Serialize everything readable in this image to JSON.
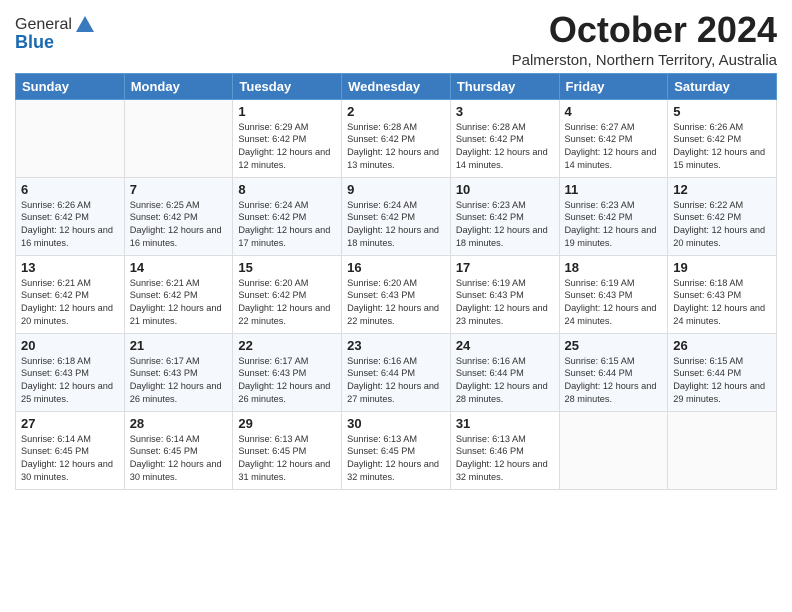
{
  "logo": {
    "general": "General",
    "blue": "Blue"
  },
  "header": {
    "month": "October 2024",
    "location": "Palmerston, Northern Territory, Australia"
  },
  "weekdays": [
    "Sunday",
    "Monday",
    "Tuesday",
    "Wednesday",
    "Thursday",
    "Friday",
    "Saturday"
  ],
  "weeks": [
    [
      {
        "day": "",
        "sunrise": "",
        "sunset": "",
        "daylight": ""
      },
      {
        "day": "",
        "sunrise": "",
        "sunset": "",
        "daylight": ""
      },
      {
        "day": "1",
        "sunrise": "Sunrise: 6:29 AM",
        "sunset": "Sunset: 6:42 PM",
        "daylight": "Daylight: 12 hours and 12 minutes."
      },
      {
        "day": "2",
        "sunrise": "Sunrise: 6:28 AM",
        "sunset": "Sunset: 6:42 PM",
        "daylight": "Daylight: 12 hours and 13 minutes."
      },
      {
        "day": "3",
        "sunrise": "Sunrise: 6:28 AM",
        "sunset": "Sunset: 6:42 PM",
        "daylight": "Daylight: 12 hours and 14 minutes."
      },
      {
        "day": "4",
        "sunrise": "Sunrise: 6:27 AM",
        "sunset": "Sunset: 6:42 PM",
        "daylight": "Daylight: 12 hours and 14 minutes."
      },
      {
        "day": "5",
        "sunrise": "Sunrise: 6:26 AM",
        "sunset": "Sunset: 6:42 PM",
        "daylight": "Daylight: 12 hours and 15 minutes."
      }
    ],
    [
      {
        "day": "6",
        "sunrise": "Sunrise: 6:26 AM",
        "sunset": "Sunset: 6:42 PM",
        "daylight": "Daylight: 12 hours and 16 minutes."
      },
      {
        "day": "7",
        "sunrise": "Sunrise: 6:25 AM",
        "sunset": "Sunset: 6:42 PM",
        "daylight": "Daylight: 12 hours and 16 minutes."
      },
      {
        "day": "8",
        "sunrise": "Sunrise: 6:24 AM",
        "sunset": "Sunset: 6:42 PM",
        "daylight": "Daylight: 12 hours and 17 minutes."
      },
      {
        "day": "9",
        "sunrise": "Sunrise: 6:24 AM",
        "sunset": "Sunset: 6:42 PM",
        "daylight": "Daylight: 12 hours and 18 minutes."
      },
      {
        "day": "10",
        "sunrise": "Sunrise: 6:23 AM",
        "sunset": "Sunset: 6:42 PM",
        "daylight": "Daylight: 12 hours and 18 minutes."
      },
      {
        "day": "11",
        "sunrise": "Sunrise: 6:23 AM",
        "sunset": "Sunset: 6:42 PM",
        "daylight": "Daylight: 12 hours and 19 minutes."
      },
      {
        "day": "12",
        "sunrise": "Sunrise: 6:22 AM",
        "sunset": "Sunset: 6:42 PM",
        "daylight": "Daylight: 12 hours and 20 minutes."
      }
    ],
    [
      {
        "day": "13",
        "sunrise": "Sunrise: 6:21 AM",
        "sunset": "Sunset: 6:42 PM",
        "daylight": "Daylight: 12 hours and 20 minutes."
      },
      {
        "day": "14",
        "sunrise": "Sunrise: 6:21 AM",
        "sunset": "Sunset: 6:42 PM",
        "daylight": "Daylight: 12 hours and 21 minutes."
      },
      {
        "day": "15",
        "sunrise": "Sunrise: 6:20 AM",
        "sunset": "Sunset: 6:42 PM",
        "daylight": "Daylight: 12 hours and 22 minutes."
      },
      {
        "day": "16",
        "sunrise": "Sunrise: 6:20 AM",
        "sunset": "Sunset: 6:43 PM",
        "daylight": "Daylight: 12 hours and 22 minutes."
      },
      {
        "day": "17",
        "sunrise": "Sunrise: 6:19 AM",
        "sunset": "Sunset: 6:43 PM",
        "daylight": "Daylight: 12 hours and 23 minutes."
      },
      {
        "day": "18",
        "sunrise": "Sunrise: 6:19 AM",
        "sunset": "Sunset: 6:43 PM",
        "daylight": "Daylight: 12 hours and 24 minutes."
      },
      {
        "day": "19",
        "sunrise": "Sunrise: 6:18 AM",
        "sunset": "Sunset: 6:43 PM",
        "daylight": "Daylight: 12 hours and 24 minutes."
      }
    ],
    [
      {
        "day": "20",
        "sunrise": "Sunrise: 6:18 AM",
        "sunset": "Sunset: 6:43 PM",
        "daylight": "Daylight: 12 hours and 25 minutes."
      },
      {
        "day": "21",
        "sunrise": "Sunrise: 6:17 AM",
        "sunset": "Sunset: 6:43 PM",
        "daylight": "Daylight: 12 hours and 26 minutes."
      },
      {
        "day": "22",
        "sunrise": "Sunrise: 6:17 AM",
        "sunset": "Sunset: 6:43 PM",
        "daylight": "Daylight: 12 hours and 26 minutes."
      },
      {
        "day": "23",
        "sunrise": "Sunrise: 6:16 AM",
        "sunset": "Sunset: 6:44 PM",
        "daylight": "Daylight: 12 hours and 27 minutes."
      },
      {
        "day": "24",
        "sunrise": "Sunrise: 6:16 AM",
        "sunset": "Sunset: 6:44 PM",
        "daylight": "Daylight: 12 hours and 28 minutes."
      },
      {
        "day": "25",
        "sunrise": "Sunrise: 6:15 AM",
        "sunset": "Sunset: 6:44 PM",
        "daylight": "Daylight: 12 hours and 28 minutes."
      },
      {
        "day": "26",
        "sunrise": "Sunrise: 6:15 AM",
        "sunset": "Sunset: 6:44 PM",
        "daylight": "Daylight: 12 hours and 29 minutes."
      }
    ],
    [
      {
        "day": "27",
        "sunrise": "Sunrise: 6:14 AM",
        "sunset": "Sunset: 6:45 PM",
        "daylight": "Daylight: 12 hours and 30 minutes."
      },
      {
        "day": "28",
        "sunrise": "Sunrise: 6:14 AM",
        "sunset": "Sunset: 6:45 PM",
        "daylight": "Daylight: 12 hours and 30 minutes."
      },
      {
        "day": "29",
        "sunrise": "Sunrise: 6:13 AM",
        "sunset": "Sunset: 6:45 PM",
        "daylight": "Daylight: 12 hours and 31 minutes."
      },
      {
        "day": "30",
        "sunrise": "Sunrise: 6:13 AM",
        "sunset": "Sunset: 6:45 PM",
        "daylight": "Daylight: 12 hours and 32 minutes."
      },
      {
        "day": "31",
        "sunrise": "Sunrise: 6:13 AM",
        "sunset": "Sunset: 6:46 PM",
        "daylight": "Daylight: 12 hours and 32 minutes."
      },
      {
        "day": "",
        "sunrise": "",
        "sunset": "",
        "daylight": ""
      },
      {
        "day": "",
        "sunrise": "",
        "sunset": "",
        "daylight": ""
      }
    ]
  ]
}
